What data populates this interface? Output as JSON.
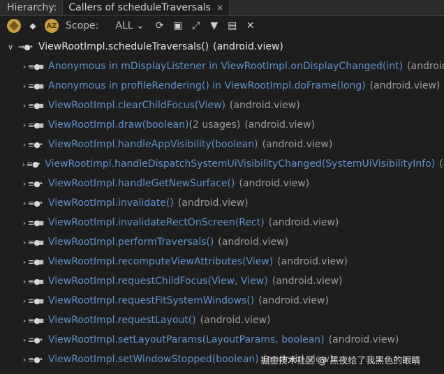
{
  "tabbar": {
    "hierarchy_label": "Hierarchy:",
    "tab_title": "Callers of scheduleTraversals",
    "close_glyph": "×"
  },
  "toolbar": {
    "scope_label": "Scope:",
    "scope_value": "ALL",
    "scope_chevron": "⌄",
    "icons": [
      "caller-hierarchy-icon",
      "callee-hierarchy-icon",
      "sort-alphabetically-icon",
      "refresh-icon",
      "terminal-icon",
      "expand-icon",
      "pin-icon",
      "export-icon",
      "close-icon"
    ]
  },
  "tree": {
    "root": {
      "method": "ViewRootImpl.scheduleTraversals()",
      "package": "(android.view)"
    },
    "callers": [
      {
        "method": "Anonymous in mDisplayListener in ViewRootImpl.onDisplayChanged(int)",
        "package": "(android.view)",
        "modifier": "lock"
      },
      {
        "method": "Anonymous in profileRendering() in ViewRootImpl.doFrame(long)",
        "package": "(android.view)",
        "modifier": "lock"
      },
      {
        "method": "ViewRootImpl.clearChildFocus(View)",
        "package": "(android.view)",
        "modifier": "lock"
      },
      {
        "method": "ViewRootImpl.draw(boolean)",
        "usages": "(2 usages)",
        "package": "(android.view)",
        "modifier": "lock"
      },
      {
        "method": "ViewRootImpl.handleAppVisibility(boolean)",
        "package": "(android.view)",
        "modifier": "dot"
      },
      {
        "method": "ViewRootImpl.handleDispatchSystemUiVisibilityChanged(SystemUiVisibilityInfo)",
        "package": "(android.view)",
        "modifier": "dot"
      },
      {
        "method": "ViewRootImpl.handleGetNewSurface()",
        "package": "(android.view)",
        "modifier": "dot"
      },
      {
        "method": "ViewRootImpl.invalidate()",
        "package": "(android.view)",
        "modifier": "dot"
      },
      {
        "method": "ViewRootImpl.invalidateRectOnScreen(Rect)",
        "package": "(android.view)",
        "modifier": "lock"
      },
      {
        "method": "ViewRootImpl.performTraversals()",
        "package": "(android.view)",
        "modifier": "lock"
      },
      {
        "method": "ViewRootImpl.recomputeViewAttributes(View)",
        "package": "(android.view)",
        "modifier": "lock"
      },
      {
        "method": "ViewRootImpl.requestChildFocus(View, View)",
        "package": "(android.view)",
        "modifier": "lock"
      },
      {
        "method": "ViewRootImpl.requestFitSystemWindows()",
        "package": "(android.view)",
        "modifier": "lock"
      },
      {
        "method": "ViewRootImpl.requestLayout()",
        "package": "(android.view)",
        "modifier": "lock"
      },
      {
        "method": "ViewRootImpl.setLayoutParams(LayoutParams, boolean)",
        "package": "(android.view)",
        "modifier": "dot"
      },
      {
        "method": "ViewRootImpl.setWindowStopped(boolean)",
        "package": "(android.view)",
        "modifier": "dot"
      }
    ]
  },
  "watermark": "掘金技术社区 @ 黑夜给了我黑色的眼睛",
  "colors": {
    "method": "#5f91cc",
    "package": "#9c9c9c",
    "background": "#1e1e1e",
    "root_text": "#e6e6e6"
  }
}
